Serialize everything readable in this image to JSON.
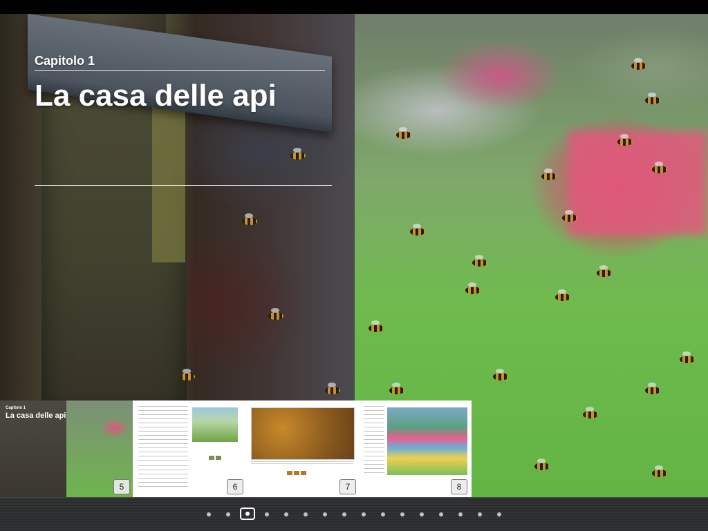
{
  "chapter": {
    "label": "Capitolo 1",
    "title": "La casa delle api"
  },
  "thumbnails": [
    {
      "page": "5",
      "kind": "cover",
      "cap": "Capitolo 1",
      "title": "La casa delle api"
    },
    {
      "page": "6",
      "kind": "text-photo"
    },
    {
      "page": "7",
      "kind": "photo"
    },
    {
      "page": "8",
      "kind": "text-photo"
    }
  ],
  "pager": {
    "total_dots": 16,
    "active_index": 2
  },
  "colors": {
    "accent_white": "#ffffff",
    "bar_background": "#2e2f31",
    "hive_pink": "#e05a7c",
    "grass_green": "#6fbb4d"
  }
}
